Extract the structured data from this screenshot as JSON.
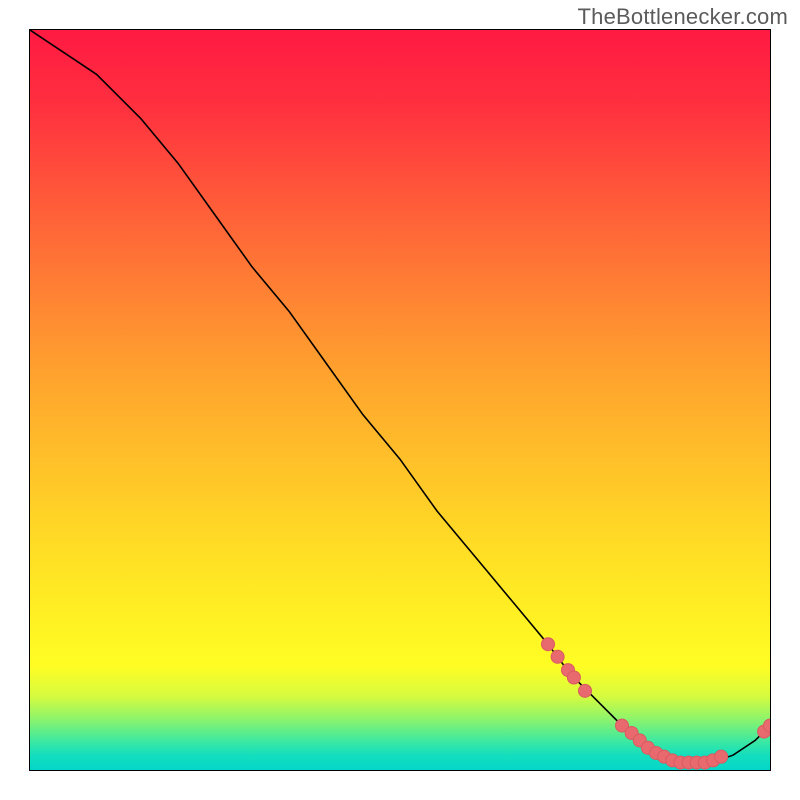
{
  "watermark": "TheBottlenecker.com",
  "chart_data": {
    "type": "line",
    "title": "",
    "xlabel": "",
    "ylabel": "",
    "xlim": [
      0,
      100
    ],
    "ylim": [
      0,
      100
    ],
    "grid": false,
    "legend": false,
    "line": {
      "x": [
        0,
        3,
        6,
        9,
        12,
        15,
        20,
        25,
        30,
        35,
        40,
        45,
        50,
        55,
        60,
        65,
        70,
        73,
        75,
        78,
        80,
        83,
        86,
        89,
        92,
        95,
        98,
        100
      ],
      "y": [
        100,
        98,
        96,
        94,
        91,
        88,
        82,
        75,
        68,
        62,
        55,
        48,
        42,
        35,
        29,
        23,
        17,
        13,
        11,
        8,
        6,
        4,
        2,
        1,
        1,
        2,
        4,
        6
      ]
    },
    "markers": [
      {
        "x": 70.0,
        "y": 17.0
      },
      {
        "x": 71.3,
        "y": 15.3
      },
      {
        "x": 72.7,
        "y": 13.5
      },
      {
        "x": 73.5,
        "y": 12.5
      },
      {
        "x": 75.0,
        "y": 10.7
      },
      {
        "x": 80.0,
        "y": 6.0
      },
      {
        "x": 81.3,
        "y": 5.0
      },
      {
        "x": 82.4,
        "y": 4.0
      },
      {
        "x": 83.5,
        "y": 3.0
      },
      {
        "x": 84.6,
        "y": 2.3
      },
      {
        "x": 85.7,
        "y": 1.8
      },
      {
        "x": 86.8,
        "y": 1.3
      },
      {
        "x": 87.9,
        "y": 1.0
      },
      {
        "x": 89.0,
        "y": 1.0
      },
      {
        "x": 90.1,
        "y": 1.0
      },
      {
        "x": 91.2,
        "y": 1.0
      },
      {
        "x": 92.3,
        "y": 1.3
      },
      {
        "x": 93.4,
        "y": 1.8
      },
      {
        "x": 99.2,
        "y": 5.2
      },
      {
        "x": 100.0,
        "y": 6.0
      }
    ]
  }
}
